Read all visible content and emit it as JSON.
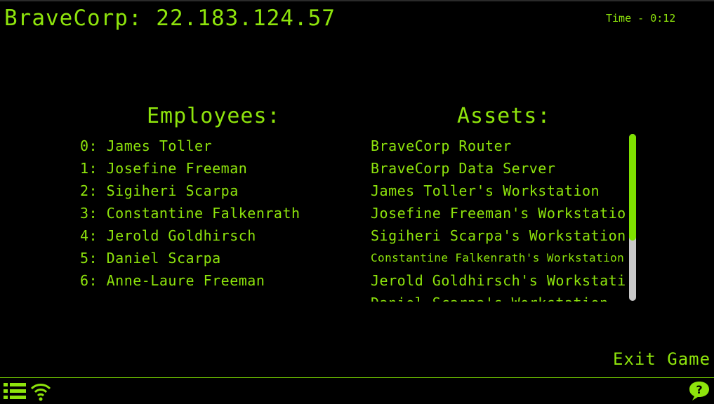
{
  "header": {
    "title": "BraveCorp: 22.183.124.57",
    "timer": "Time - 0:12"
  },
  "employees": {
    "heading": "Employees:",
    "items": [
      "0: James Toller",
      "1: Josefine Freeman",
      "2: Sigiheri Scarpa",
      "3: Constantine Falkenrath",
      "4: Jerold Goldhirsch",
      "5: Daniel Scarpa",
      "6: Anne-Laure Freeman"
    ]
  },
  "assets": {
    "heading": "Assets:",
    "items": [
      "BraveCorp Router",
      "BraveCorp Data Server",
      "James Toller's Workstation",
      "Josefine Freeman's Workstation",
      "Sigiheri Scarpa's Workstation",
      "Constantine Falkenrath's Workstation",
      "Jerold Goldhirsch's Workstation",
      "Daniel Scarpa's Workstation"
    ]
  },
  "exit_label": "Exit Game",
  "taskbar": {
    "icons": [
      "menu-icon",
      "wifi-icon",
      "help-icon"
    ]
  },
  "colors": {
    "accent": "#8ee40c",
    "background": "#000000",
    "scroll_thumb": "#7fe000",
    "scroll_track": "#c8c8c8"
  }
}
